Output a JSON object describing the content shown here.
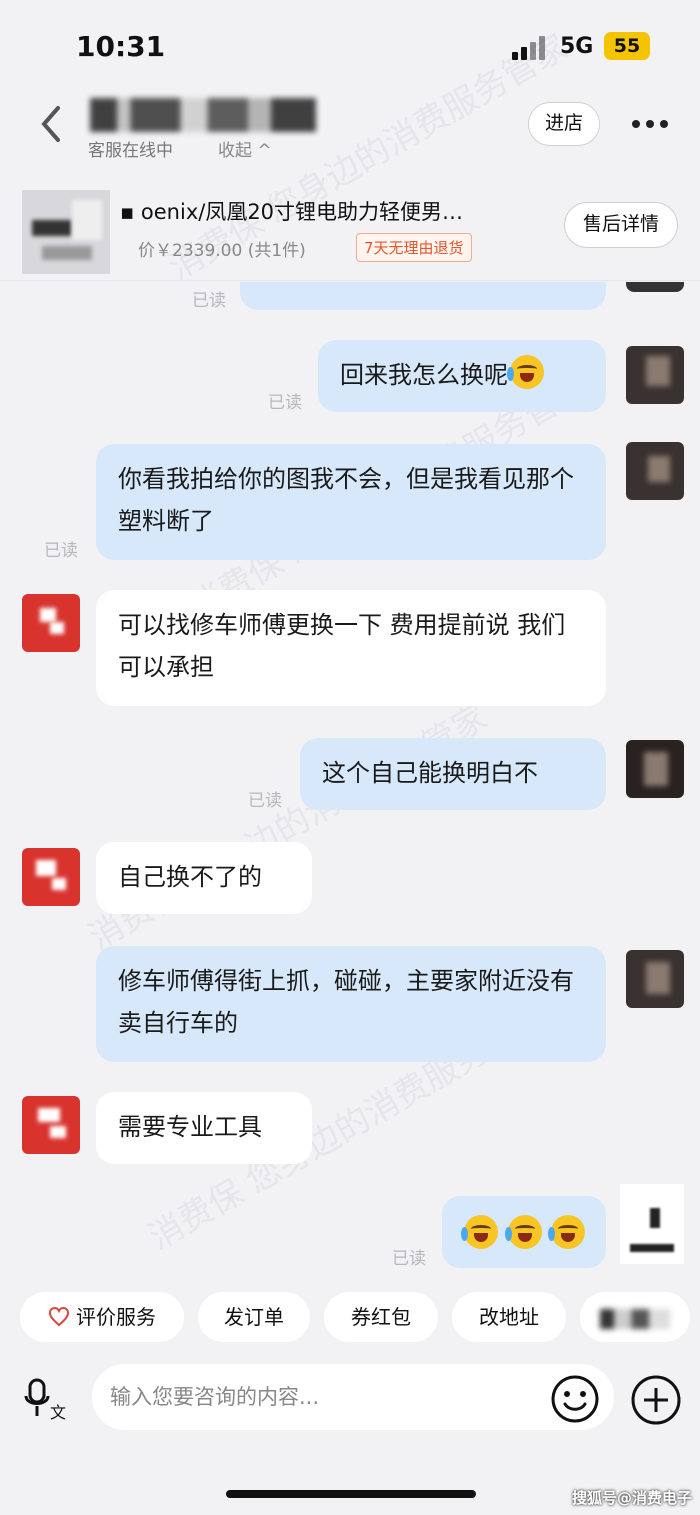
{
  "status_bar": {
    "time": "10:31",
    "network": "5G",
    "battery": "55"
  },
  "header": {
    "status": "客服在线中",
    "collapse": "收起 ^",
    "enter_store": "进店"
  },
  "product": {
    "title": "▪ oenix/凤凰20寸锂电助力轻便男…",
    "price": "价￥2339.00 (共1件)",
    "badge": "7天无理由退货",
    "after_sale": "售后详情"
  },
  "messages": {
    "read_label": "已读",
    "m1": "回来我怎么换呢",
    "m2": "你看我拍给你的图我不会，但是我看见那个塑料断了",
    "m3": "可以找修车师傅更换一下 费用提前说 我们可以承担",
    "m4": "这个自己能换明白不",
    "m5": "自己换不了的",
    "m6": "修车师傅得街上抓，碰碰，主要家附近没有卖自行车的",
    "m7": "需要专业工具"
  },
  "watermark": [
    "消费保 您身边的消费服务管家"
  ],
  "quick_actions": [
    "评价服务",
    "发订单",
    "券红包",
    "改地址"
  ],
  "input": {
    "placeholder": "输入您要咨询的内容..."
  },
  "source_mark": "搜狐号@消费电子",
  "icons": {
    "back": "back-arrow-icon",
    "more": "more-dots-icon",
    "rate": "heart-rate-icon",
    "mic": "voice-text-icon",
    "emoji": "smile-icon",
    "plus": "plus-icon"
  }
}
